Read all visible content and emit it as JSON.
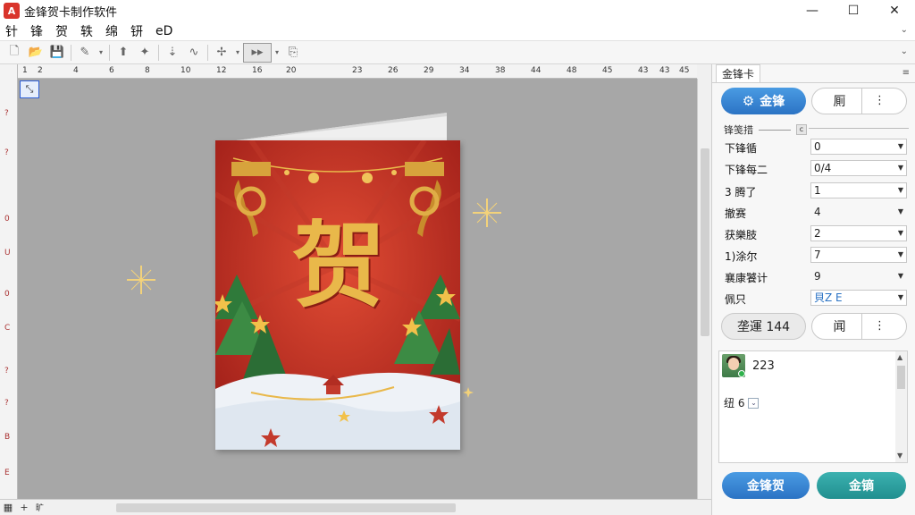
{
  "window": {
    "title": "金锋贺卡制作软件",
    "logo_text": "A",
    "controls": {
      "minimize": "—",
      "maximize": "☐",
      "close": "✕"
    }
  },
  "menu": {
    "items": [
      "针",
      "锋",
      "贺",
      "轶",
      "绵",
      "钘",
      "eD"
    ],
    "overflow": "⌄"
  },
  "toolbar": {
    "icons": [
      "new-document-icon",
      "open-folder-icon",
      "save-icon",
      "brush-icon",
      "insert-icon",
      "star-icon",
      "arrow-icon",
      "wave-icon",
      "align-icon",
      "play-icon",
      "export-icon"
    ],
    "glyphs": {
      "new": "🗋",
      "open": "📂",
      "save": "💾",
      "brush": "✎",
      "dropdown": "▾",
      "insert": "⬆",
      "star": "✦",
      "arrow": "⇣",
      "wave": "∿",
      "align": "✢",
      "play": "▸▸",
      "export": "⎘"
    },
    "overflow": "⌄"
  },
  "ruler": {
    "ticks": [
      "1",
      "2",
      "4",
      "6",
      "8",
      "10",
      "12",
      "16",
      "20",
      "23",
      "26",
      "29",
      "34",
      "38",
      "44",
      "48",
      "45",
      "43",
      "43",
      "45"
    ],
    "vertical_marks": [
      "?",
      "?",
      "0",
      "U",
      "0",
      "C",
      "?",
      "?",
      "B",
      "E"
    ]
  },
  "canvas": {
    "card_glyph": "贺",
    "corner_label": "⤡",
    "bottom": {
      "label": "旷",
      "add": "+"
    }
  },
  "panel": {
    "tab": "金锋卡",
    "menu_icon": "≡",
    "primary_button": "金锋",
    "secondary_button": "厠",
    "more": "⋮",
    "section_label": "锋笺措",
    "section_chip": "c",
    "properties": [
      {
        "label": "下锋循",
        "value": "0",
        "dropdown": true
      },
      {
        "label": "下锋每二",
        "value": "0/4",
        "dropdown": true
      },
      {
        "label": "3 腾了",
        "value": "1",
        "dropdown": true
      },
      {
        "label": "撤赛",
        "value": "4",
        "dropdown": true
      },
      {
        "label": "获樂肢",
        "value": "2",
        "dropdown": true
      },
      {
        "label": "1)涂尔",
        "value": "7",
        "dropdown": true
      },
      {
        "label": "襄康饕计",
        "value": "9",
        "dropdown": true
      },
      {
        "label": "佩只",
        "value": "貝Z E",
        "dropdown": true
      }
    ],
    "action_button": "垄運 144",
    "action_secondary": "闻",
    "list": {
      "count": "223",
      "sub_label": "纽 6",
      "sub_chip": "⌄"
    },
    "footer_buttons": {
      "left": "金锋贺",
      "right": "金镝"
    }
  },
  "colors": {
    "accent_blue": "#2b73c4",
    "accent_teal": "#218f8f",
    "card_red": "#b6281f",
    "gold": "#e9b84a",
    "canvas_grey": "#a7a7a7"
  }
}
